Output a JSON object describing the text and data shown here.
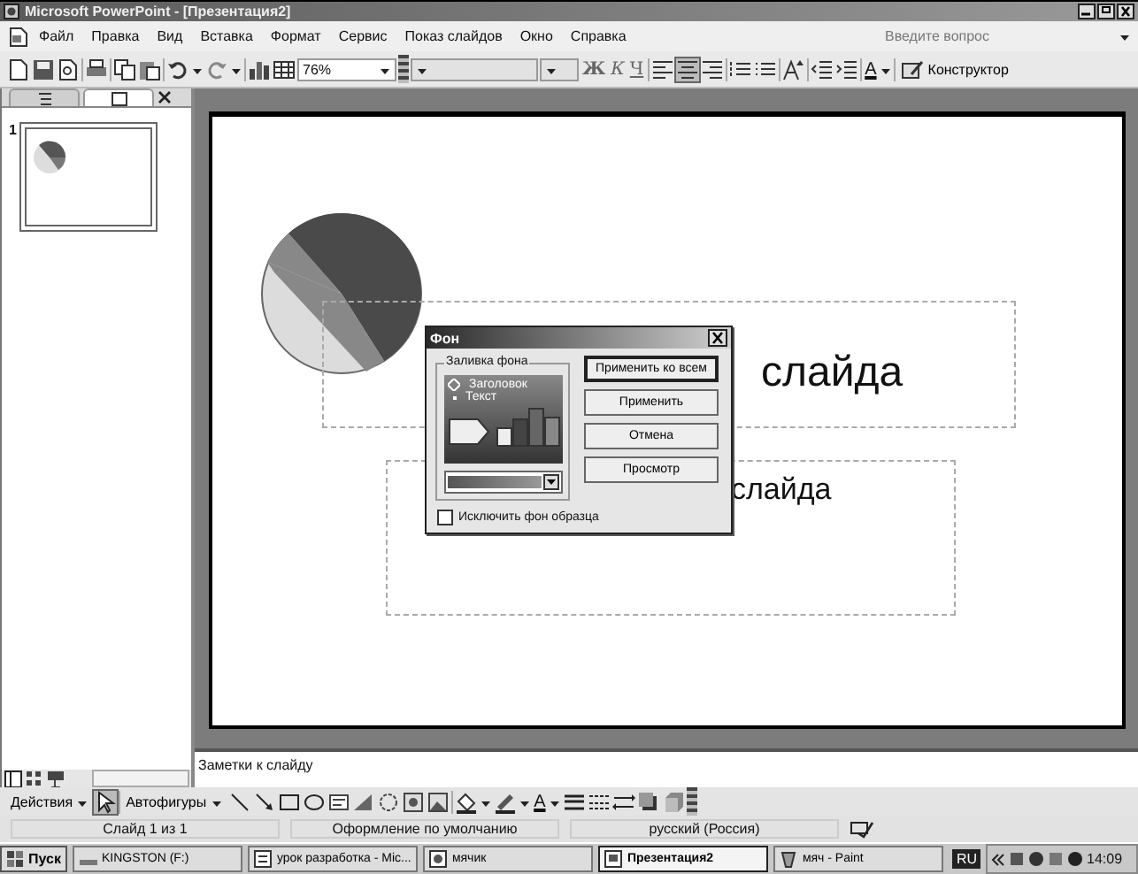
{
  "window": {
    "title": "Microsoft PowerPoint - [Презентация2]"
  },
  "menu": {
    "items": [
      "Файл",
      "Правка",
      "Вид",
      "Вставка",
      "Формат",
      "Сервис",
      "Показ слайдов",
      "Окно",
      "Справка"
    ],
    "help_placeholder": "Введите вопрос"
  },
  "toolbar": {
    "zoom": "76%",
    "format_buttons": [
      "Ж",
      "К",
      "Ч"
    ],
    "font_color": "A",
    "design_button": "Конструктор"
  },
  "left_panel": {
    "tabs": [
      {
        "selected": false
      },
      {
        "selected": true
      }
    ],
    "slides": [
      {
        "number": "1",
        "selected": true
      }
    ]
  },
  "slide": {
    "title_text": "слайда",
    "subtitle_text": "слайда"
  },
  "dialog": {
    "title": "Фон",
    "group_label": "Заливка фона",
    "preview_title": "Заголовок",
    "preview_bullet": "Текст",
    "buttons": [
      {
        "label": "Применить ко всем",
        "default": true
      },
      {
        "label": "Применить",
        "default": false
      },
      {
        "label": "Отмена",
        "default": false
      },
      {
        "label": "Просмотр",
        "default": false
      }
    ],
    "checkbox": {
      "label": "Исключить фон образца",
      "checked": false
    }
  },
  "notes": {
    "text": "Заметки к слайду"
  },
  "drawing_toolbar": {
    "actions": "Действия",
    "autoshapes": "Автофигуры",
    "font_color": "A"
  },
  "status_bar": [
    "Слайд 1 из 1",
    "Оформление по умолчанию",
    "русский (Россия)"
  ],
  "taskbar": {
    "start": "Пуск",
    "tasks": [
      {
        "label": "KINGSTON (F:)",
        "selected": false
      },
      {
        "label": "урок разработка - Mic...",
        "selected": false
      },
      {
        "label": "мячик",
        "selected": false
      },
      {
        "label": "Презентация2",
        "selected": true
      },
      {
        "label": "мяч - Paint",
        "selected": false
      }
    ],
    "language": "RU",
    "clock": "14:09"
  }
}
